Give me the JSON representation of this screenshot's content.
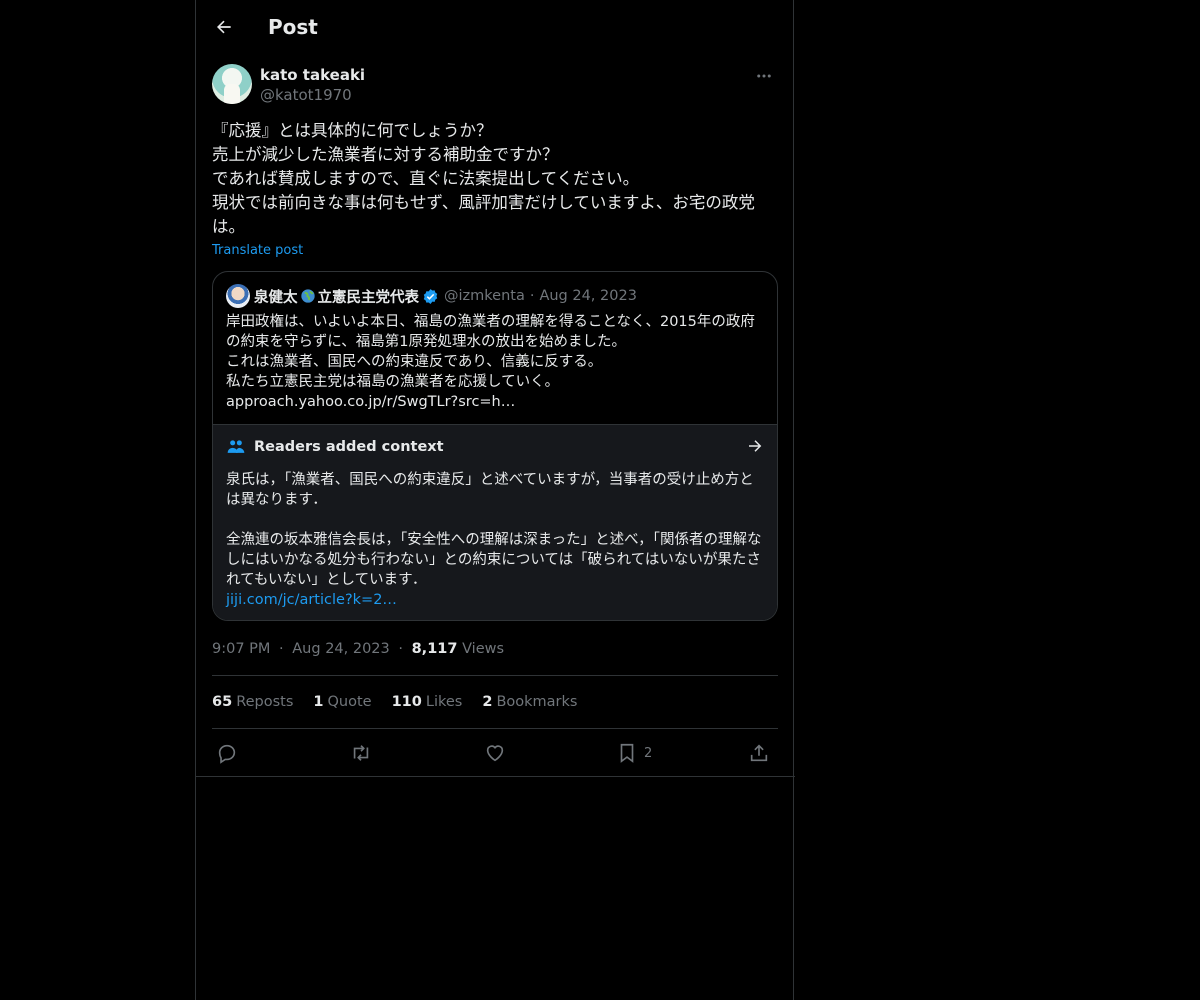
{
  "header": {
    "title": "Post"
  },
  "author": {
    "display_name": "kato takeaki",
    "handle": "@katot1970"
  },
  "post": {
    "text": "『応援』とは具体的に何でしょうか？\n売上が減少した漁業者に対する補助金ですか？\nであれば賛成しますので、直ぐに法案提出してください。\n現状では前向きな事は何もせず、風評加害だけしていますよ、お宅の政党は。",
    "translate_label": "Translate post"
  },
  "quote": {
    "name_part1": "泉健太",
    "name_part2": "立憲民主党代表",
    "handle": "@izmkenta",
    "dot": "·",
    "date": "Aug 24, 2023",
    "text": "岸田政権は、いよいよ本日、福島の漁業者の理解を得ることなく、2015年の政府の約束を守らずに、福島第1原発処理水の放出を始めました。\nこれは漁業者、国民への約束違反であり、信義に反する。\n私たち立憲民主党は福島の漁業者を応援していく。\napproach.yahoo.co.jp/r/SwgTLr?src=h…"
  },
  "context": {
    "title": "Readers added context",
    "text": "泉氏は，「漁業者、国民への約束違反」と述べていますが，当事者の受け止め方とは異なります．\n\n全漁連の坂本雅信会長は，「安全性への理解は深まった」と述べ，「関係者の理解なしにはいかなる処分も行わない」との約束については「破られてはいないが果たされてもいない」としています．",
    "link": "jiji.com/jc/article?k=2…"
  },
  "meta": {
    "time": "9:07 PM",
    "sep1": "·",
    "date": "Aug 24, 2023",
    "sep2": "·",
    "views_count": "8,117",
    "views_label": "Views"
  },
  "stats": {
    "reposts_count": "65",
    "reposts_label": "Reposts",
    "quotes_count": "1",
    "quotes_label": "Quote",
    "likes_count": "110",
    "likes_label": "Likes",
    "bookmarks_count": "2",
    "bookmarks_label": "Bookmarks"
  },
  "actions": {
    "bookmark_count": "2"
  },
  "colors": {
    "accent": "#1d9bf0",
    "background": "#000000",
    "muted": "#71767b"
  }
}
